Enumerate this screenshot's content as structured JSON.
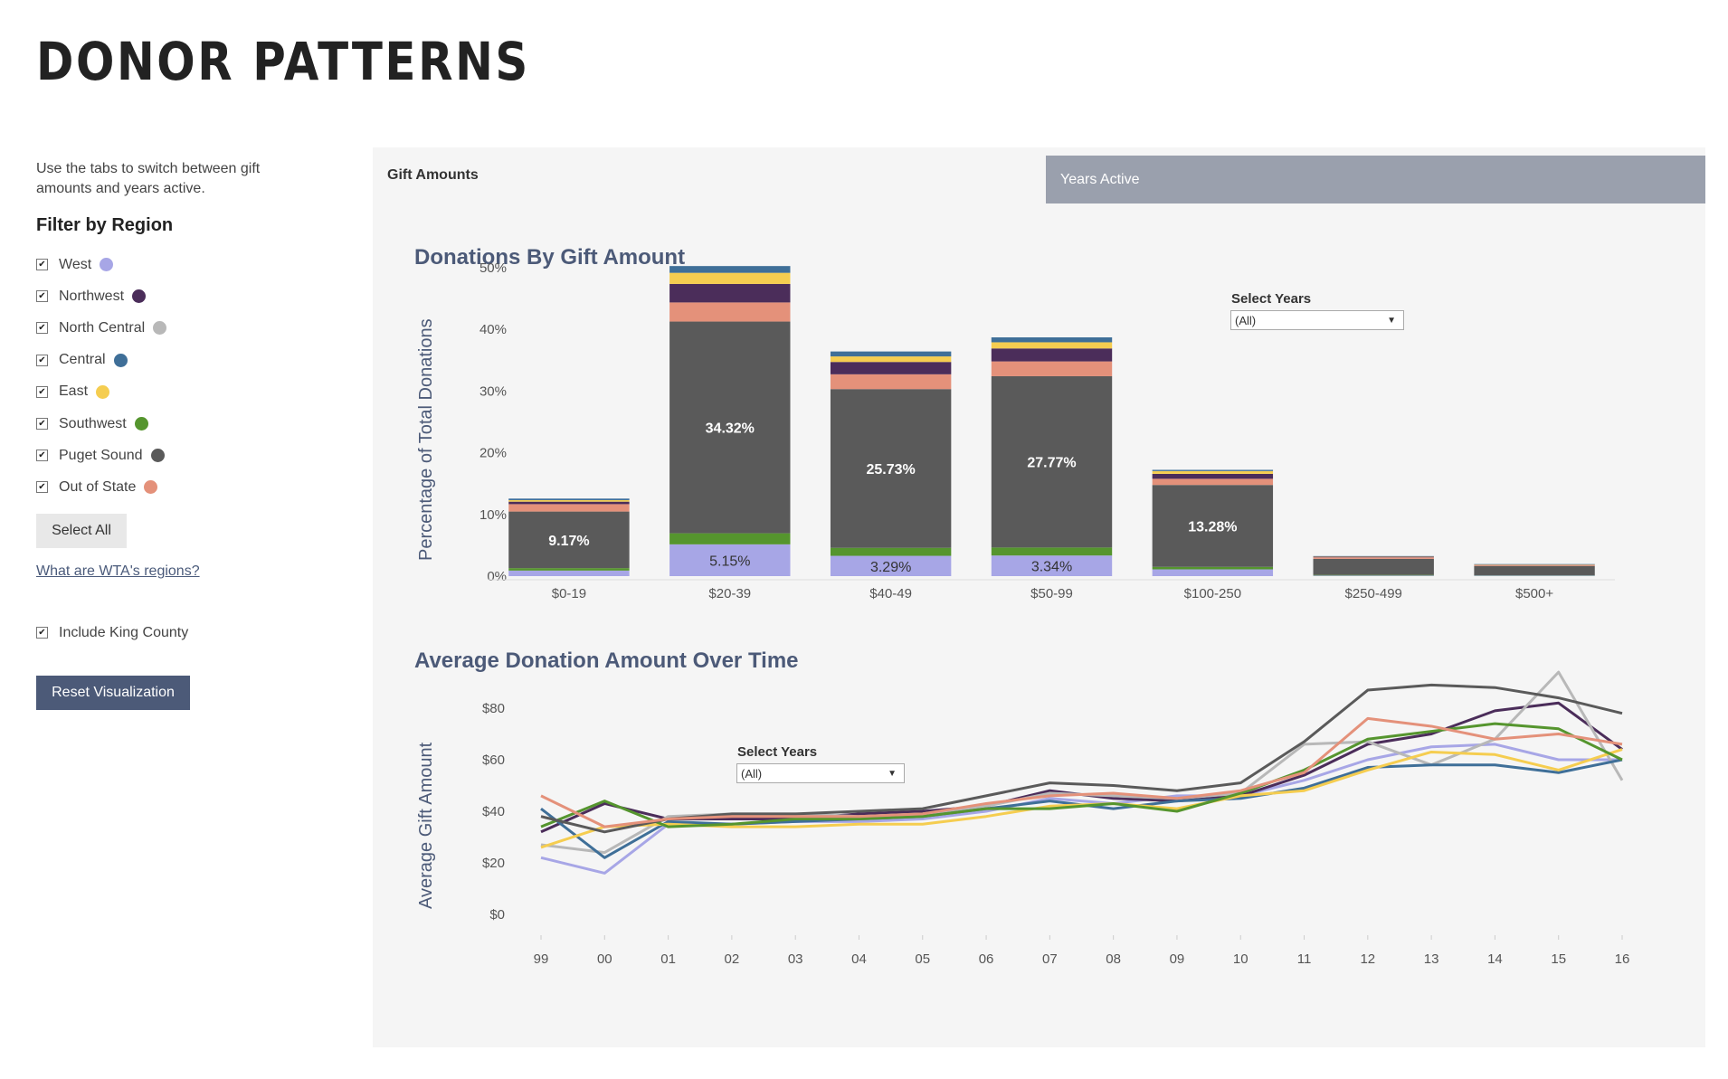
{
  "page": {
    "title": "DONOR PATTERNS"
  },
  "sidebar": {
    "intro": "Use the tabs to switch between gift amounts and years active.",
    "filter_title": "Filter by Region",
    "regions": [
      {
        "label": "West",
        "color": "#a7a6e6",
        "checked": true
      },
      {
        "label": "Northwest",
        "color": "#4b2d5a",
        "checked": true
      },
      {
        "label": "North Central",
        "color": "#b8b8b8",
        "checked": true
      },
      {
        "label": "Central",
        "color": "#3f6f98",
        "checked": true
      },
      {
        "label": "East",
        "color": "#f5cd50",
        "checked": true
      },
      {
        "label": "Southwest",
        "color": "#55952e",
        "checked": true
      },
      {
        "label": "Puget Sound",
        "color": "#5a5a5a",
        "checked": true
      },
      {
        "label": "Out of State",
        "color": "#e4917a",
        "checked": true
      }
    ],
    "select_all_label": "Select All",
    "regions_link": "What are WTA's regions?",
    "king_county_label": "Include King County",
    "king_county_checked": true,
    "reset_label": "Reset Visualization"
  },
  "tabs": [
    {
      "label": "Gift Amounts",
      "active": true
    },
    {
      "label": "Years Active",
      "active": false
    }
  ],
  "bar_chart": {
    "title": "Donations By Gift Amount",
    "select_label": "Select Years",
    "select_value": "(All)"
  },
  "line_chart": {
    "title": "Average Donation Amount Over Time",
    "select_label": "Select Years",
    "select_value": "(All)"
  },
  "chart_data": [
    {
      "type": "bar",
      "stacked": true,
      "title": "Donations By Gift Amount",
      "ylabel": "Percentage of Total Donations",
      "categories": [
        "$0-19",
        "$20-39",
        "$40-49",
        "$50-99",
        "$100-250",
        "$250-499",
        "$500+"
      ],
      "yticks": [
        "0%",
        "10%",
        "20%",
        "30%",
        "40%",
        "50%"
      ],
      "ylim": [
        0,
        50
      ],
      "series": [
        {
          "name": "West",
          "color": "#a7a6e6",
          "values": [
            0.9,
            5.15,
            3.29,
            3.34,
            1.1,
            0.1,
            0.1
          ]
        },
        {
          "name": "Southwest",
          "color": "#55952e",
          "values": [
            0.4,
            1.8,
            1.3,
            1.3,
            0.4,
            0.1,
            0.05
          ]
        },
        {
          "name": "Puget Sound",
          "color": "#5a5a5a",
          "values": [
            9.17,
            34.32,
            25.73,
            27.77,
            13.28,
            2.6,
            1.5
          ]
        },
        {
          "name": "Out of State",
          "color": "#e4917a",
          "values": [
            1.2,
            3.1,
            2.4,
            2.4,
            1.0,
            0.25,
            0.15
          ]
        },
        {
          "name": "Northwest",
          "color": "#4b2d5a",
          "values": [
            0.4,
            3.0,
            2.0,
            2.1,
            0.8,
            0.1,
            0.05
          ]
        },
        {
          "name": "East",
          "color": "#f5cd50",
          "values": [
            0.25,
            1.8,
            0.9,
            1.0,
            0.45,
            0.05,
            0.05
          ]
        },
        {
          "name": "Central",
          "color": "#3f6f98",
          "values": [
            0.25,
            1.1,
            0.8,
            0.8,
            0.2,
            0.05,
            0.05
          ]
        }
      ],
      "labels": {
        "series": [
          "West",
          "Puget Sound"
        ],
        "values": [
          [
            null,
            "5.15%",
            "3.29%",
            "3.34%",
            null,
            null,
            null
          ],
          [
            "9.17%",
            "34.32%",
            "25.73%",
            "27.77%",
            "13.28%",
            null,
            null
          ]
        ]
      }
    },
    {
      "type": "line",
      "title": "Average Donation Amount Over Time",
      "ylabel": "Average Gift Amount",
      "x": [
        "99",
        "00",
        "01",
        "02",
        "03",
        "04",
        "05",
        "06",
        "07",
        "08",
        "09",
        "10",
        "11",
        "12",
        "13",
        "14",
        "15",
        "16"
      ],
      "yticks": [
        "$0",
        "$20",
        "$40",
        "$60",
        "$80"
      ],
      "ylim": [
        0,
        85
      ],
      "series": [
        {
          "name": "West",
          "color": "#a7a6e6",
          "values": [
            22,
            16,
            35,
            35,
            36,
            36,
            37,
            40,
            45,
            43,
            46,
            46,
            52,
            60,
            65,
            66,
            60,
            60
          ]
        },
        {
          "name": "Northwest",
          "color": "#4b2d5a",
          "values": [
            32,
            43,
            37,
            37,
            37,
            39,
            40,
            42,
            48,
            45,
            44,
            46,
            54,
            66,
            70,
            79,
            82,
            64
          ]
        },
        {
          "name": "North Central",
          "color": "#b8b8b8",
          "values": [
            27,
            24,
            38,
            39,
            39,
            38,
            39,
            42,
            47,
            46,
            45,
            47,
            66,
            67,
            58,
            68,
            94,
            52
          ]
        },
        {
          "name": "Central",
          "color": "#3f6f98",
          "values": [
            41,
            22,
            36,
            35,
            36,
            37,
            38,
            41,
            44,
            41,
            44,
            45,
            49,
            57,
            58,
            58,
            55,
            60
          ]
        },
        {
          "name": "East",
          "color": "#f5cd50",
          "values": [
            26,
            34,
            35,
            34,
            34,
            35,
            35,
            38,
            42,
            43,
            41,
            46,
            48,
            56,
            63,
            62,
            56,
            64
          ]
        },
        {
          "name": "Southwest",
          "color": "#55952e",
          "values": [
            34,
            44,
            34,
            35,
            37,
            37,
            38,
            41,
            41,
            43,
            40,
            47,
            56,
            68,
            71,
            74,
            72,
            60
          ]
        },
        {
          "name": "Puget Sound",
          "color": "#5a5a5a",
          "values": [
            38,
            32,
            37,
            39,
            39,
            40,
            41,
            46,
            51,
            50,
            48,
            51,
            67,
            87,
            89,
            88,
            84,
            78
          ]
        },
        {
          "name": "Out of State",
          "color": "#e4917a",
          "values": [
            46,
            34,
            37,
            38,
            38,
            38,
            39,
            43,
            46,
            47,
            45,
            48,
            55,
            76,
            73,
            68,
            70,
            66
          ]
        }
      ]
    }
  ]
}
